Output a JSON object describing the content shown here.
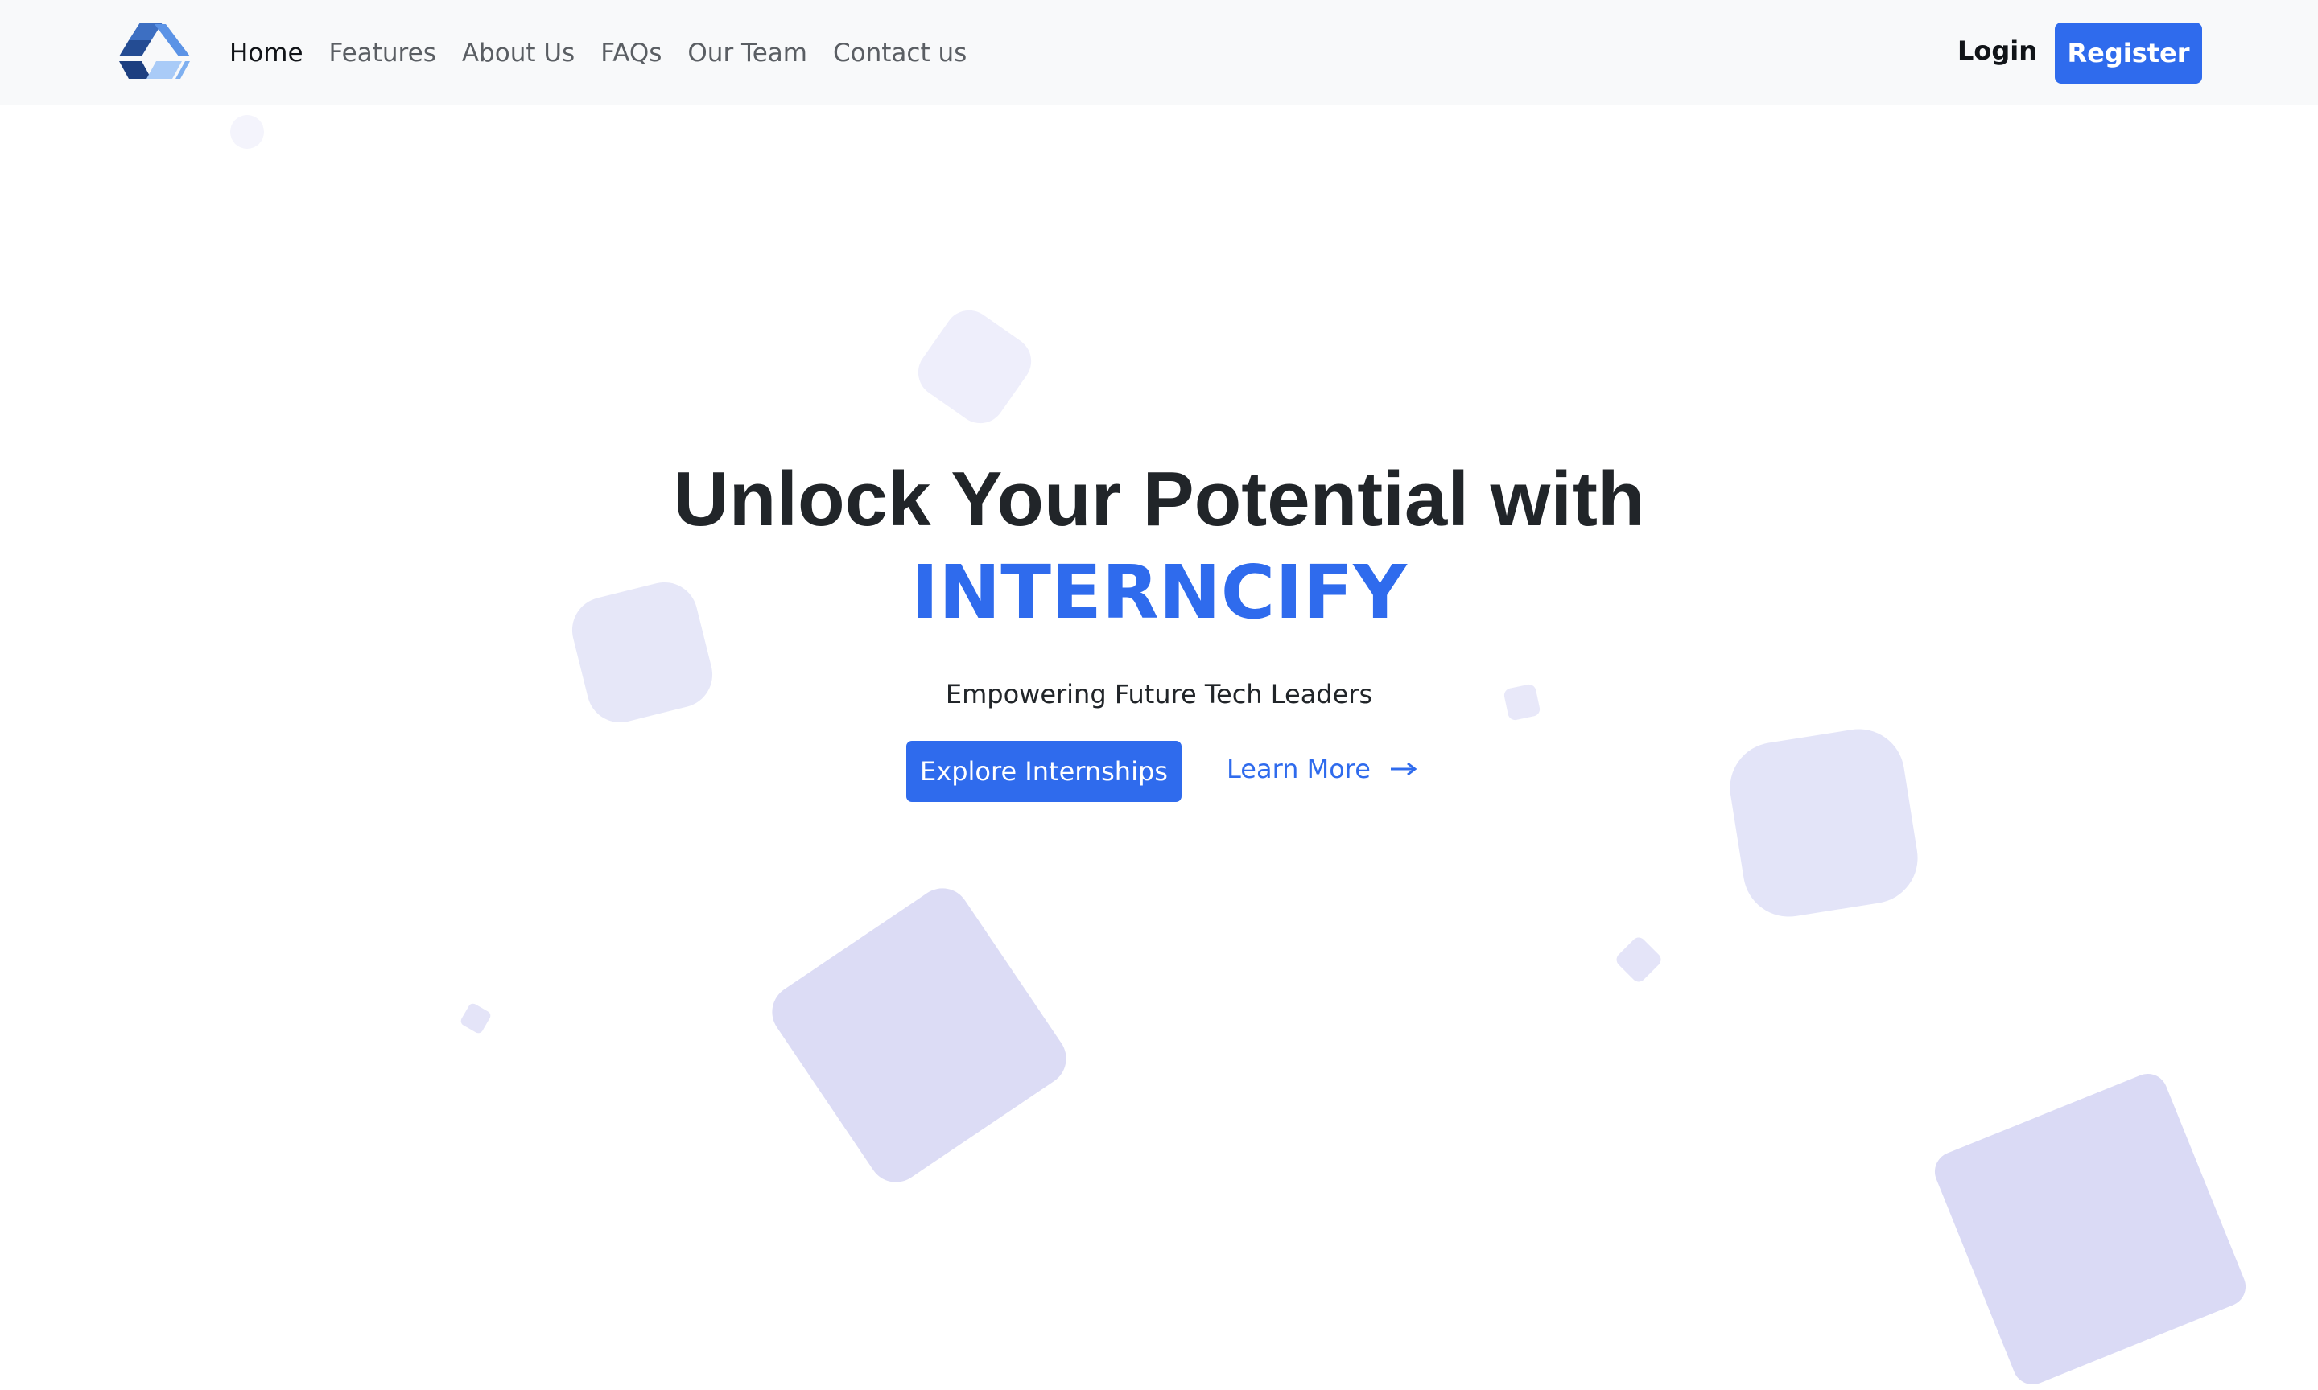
{
  "nav": {
    "logo_icon": "cube-logo-icon",
    "links": [
      {
        "label": "Home",
        "active": true
      },
      {
        "label": "Features",
        "active": false
      },
      {
        "label": "About Us",
        "active": false
      },
      {
        "label": "FAQs",
        "active": false
      },
      {
        "label": "Our Team",
        "active": false
      },
      {
        "label": "Contact us",
        "active": false
      }
    ],
    "login_label": "Login",
    "register_label": "Register"
  },
  "hero": {
    "headline": "Unlock Your Potential with",
    "brand": "INTERNCIFY",
    "tagline": "Empowering Future Tech Leaders",
    "primary_cta": "Explore Internships",
    "secondary_cta": "Learn More",
    "secondary_cta_icon": "arrow-right-icon"
  },
  "colors": {
    "accent": "#2f6bed",
    "navbar_bg": "#f8f9fa",
    "heading": "#212529",
    "shape_tint": "#dcdcf5"
  }
}
